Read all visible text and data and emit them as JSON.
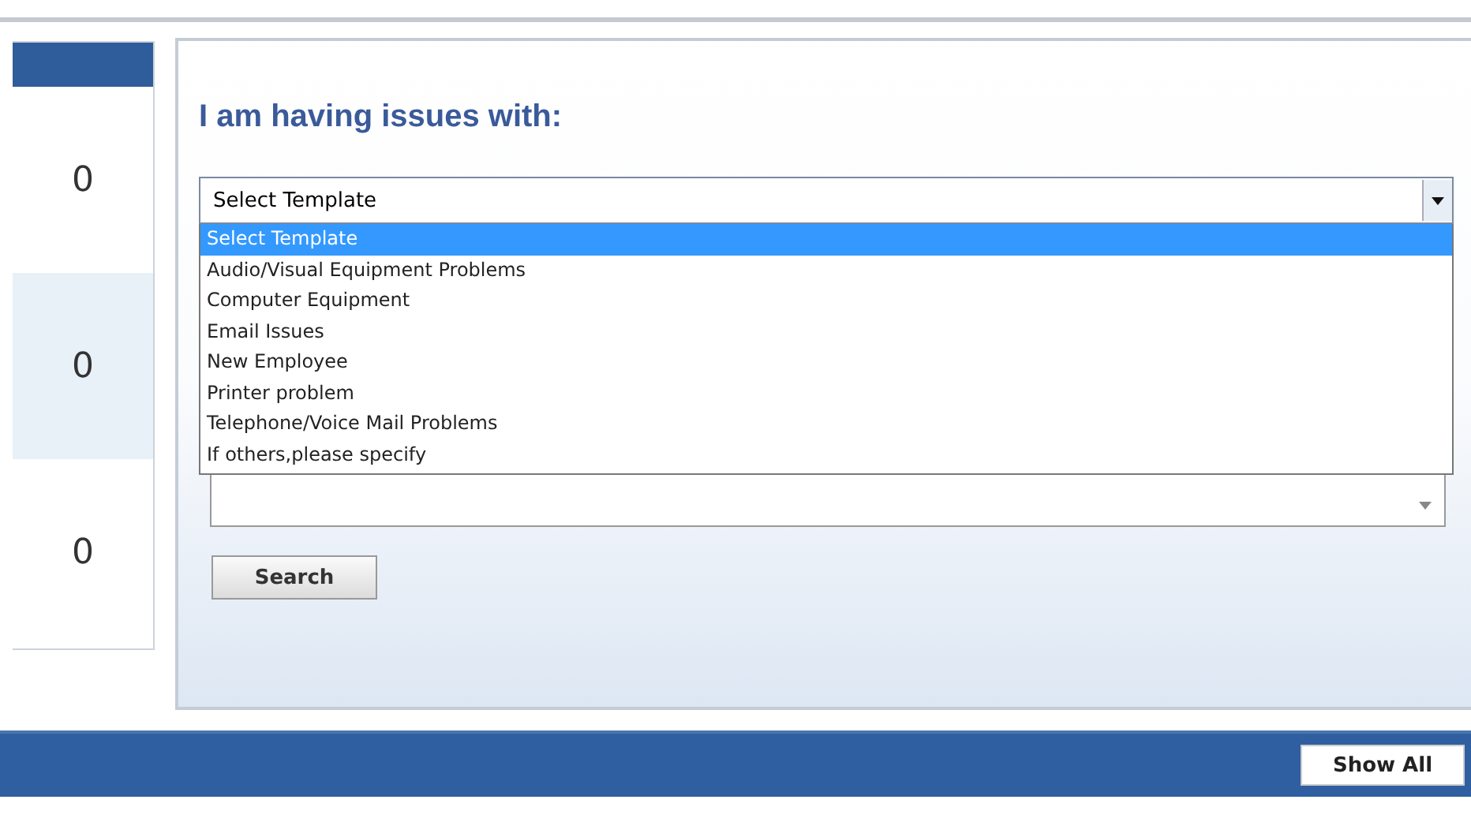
{
  "counts": [
    "0",
    "0",
    "0"
  ],
  "form": {
    "title": "I am having issues with:",
    "template_select": {
      "value": "Select Template",
      "expanded": true,
      "options": [
        {
          "label": "Select Template",
          "selected": true
        },
        {
          "label": "Audio/Visual Equipment Problems",
          "selected": false
        },
        {
          "label": "Computer Equipment",
          "selected": false
        },
        {
          "label": "Email Issues",
          "selected": false
        },
        {
          "label": "New Employee",
          "selected": false
        },
        {
          "label": "Printer problem",
          "selected": false
        },
        {
          "label": "Telephone/Voice Mail Problems",
          "selected": false
        },
        {
          "label": "If others,please specify",
          "selected": false
        }
      ]
    },
    "search_button": "Search"
  },
  "footer": {
    "show_all_button": "Show All"
  }
}
